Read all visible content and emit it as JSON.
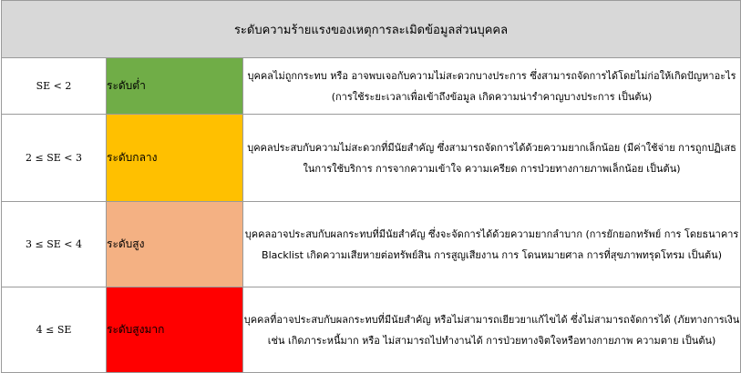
{
  "title": "ระดับความร้ายแรงของเหตุการละเมิดข้อมูลส่วนบุคคล",
  "colors": {
    "low": "#70ad47",
    "medium": "#ffc000",
    "high": "#f4b183",
    "very_high": "#ff0000",
    "header": "#d8d8d8"
  },
  "rows": [
    {
      "score": "SE < 2",
      "level": "ระดับต่ำ",
      "description": "บุคคลไม่ถูกกระทบ หรือ อาจพบเจอกับความไม่สะดวกบางประการ ซึ่งสามารถจัดการได้โดยไม่ก่อให้เกิดปัญหาอะไร (การใช้ระยะเวลาเพื่อเข้าถึงข้อมูล เกิดความน่ารำคาญบางประการ เป็นต้น)"
    },
    {
      "score": "2 ≤ SE < 3",
      "level": "ระดับกลาง",
      "description": "บุคคลประสบกับความไม่สะดวกที่มีนัยสำคัญ ซึ่งสามารถจัดการได้ด้วยความยากเล็กน้อย (มีค่าใช้จ่าย การถูกปฏิเสธในการใช้บริการ การจากความเข้าใจ ความเครียด การป่วยทางกายภาพเล็กน้อย เป็นต้น)"
    },
    {
      "score": "3 ≤ SE < 4",
      "level": "ระดับสูง",
      "description": "บุคคลอาจประสบกับผลกระทบที่มีนัยสำคัญ ซึ่งจะจัดการได้ด้วยความยากลำบาก (การยักยอกทรัพย์ การ โดยธนาคาร Blacklist เกิดความเสียหายต่อทรัพย์สิน การสูญเสียงาน การ โดนหมายศาล การที่สุขภาพทรุดโทรม เป็นต้น)"
    },
    {
      "score": "4 ≤ SE",
      "level": "ระดับสูงมาก",
      "description": "บุคคลที่อาจประสบกับผลกระทบที่มีนัยสำคัญ หรือไม่สามารถเยียวยาแก้ไขได้ ซึ่งไม่สามารถจัดการได้ (ภัยทางการเงิน เช่น เกิดภาระหนี้มาก หรือ ไม่สามารถไปทำงานได้ การป่วยทางจิตใจหรือทางกายภาพ ความตาย เป็นต้น)"
    }
  ]
}
